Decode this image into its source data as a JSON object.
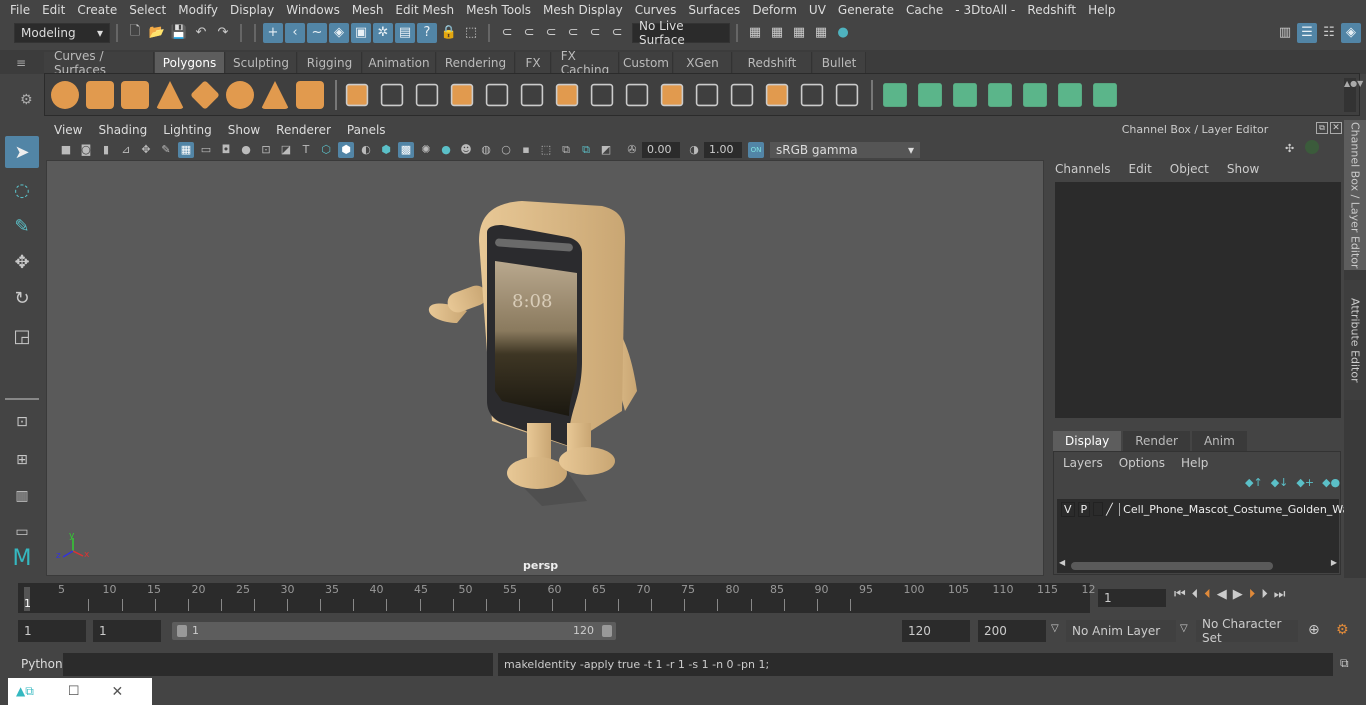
{
  "menubar": {
    "items": [
      "File",
      "Edit",
      "Create",
      "Select",
      "Modify",
      "Display",
      "Windows",
      "Mesh",
      "Edit Mesh",
      "Mesh Tools",
      "Mesh Display",
      "Curves",
      "Surfaces",
      "Deform",
      "UV",
      "Generate",
      "Cache",
      "- 3DtoAll -",
      "Redshift",
      "Help"
    ]
  },
  "statusline": {
    "mode": "Modeling",
    "live_surface": "No Live Surface"
  },
  "shelf": {
    "tabs": [
      "Curves / Surfaces",
      "Polygons",
      "Sculpting",
      "Rigging",
      "Animation",
      "Rendering",
      "FX",
      "FX Caching",
      "Custom",
      "XGen",
      "Redshift",
      "Bullet"
    ],
    "active_tab": "Polygons"
  },
  "viewport": {
    "menu": [
      "View",
      "Shading",
      "Lighting",
      "Show",
      "Renderer",
      "Panels"
    ],
    "exposure": "0.00",
    "gamma": "1.00",
    "color_space": "sRGB gamma",
    "camera_label": "persp",
    "toggle_on": "ON",
    "screen_time": "8:08",
    "axis": {
      "x": "x",
      "y": "y",
      "z": "z"
    }
  },
  "channelbox": {
    "title": "Channel Box / Layer Editor",
    "menu": [
      "Channels",
      "Edit",
      "Object",
      "Show"
    ]
  },
  "layers": {
    "tabs": [
      "Display",
      "Render",
      "Anim"
    ],
    "active_tab": "Display",
    "menu": [
      "Layers",
      "Options",
      "Help"
    ],
    "rows": [
      {
        "v": "V",
        "p": "P",
        "name": "Cell_Phone_Mascot_Costume_Golden_Walk"
      }
    ]
  },
  "sidetabs": [
    "Channel Box / Layer Editor",
    "Attribute Editor"
  ],
  "timeline": {
    "ticks": [
      "5",
      "10",
      "15",
      "20",
      "25",
      "30",
      "35",
      "40",
      "45",
      "50",
      "55",
      "60",
      "65",
      "70",
      "75",
      "80",
      "85",
      "90",
      "95",
      "100",
      "105",
      "110",
      "115",
      "12"
    ],
    "current_frame": "1",
    "frame_field": "1"
  },
  "range": {
    "start": "1",
    "playback_start": "1",
    "slider_start": "1",
    "slider_end": "120",
    "playback_end": "120",
    "end": "200",
    "anim_layer": "No Anim Layer",
    "character_set": "No Character Set"
  },
  "cmd": {
    "lang": "Python",
    "input": "",
    "output": "makeIdentity -apply true -t 1 -r 1 -s 1 -n 0 -pn 1;"
  }
}
